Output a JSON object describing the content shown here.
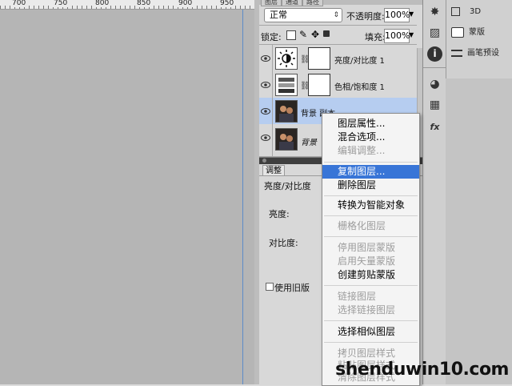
{
  "ruler": {
    "labels": [
      "700",
      "750",
      "800",
      "850",
      "900",
      "950"
    ]
  },
  "layers_panel": {
    "tab_layers": "图层",
    "tab_channels": "通道",
    "tab_paths": "路径",
    "blend_mode": "正常",
    "opacity_label": "不透明度:",
    "opacity_value": "100%",
    "lock_label": "锁定:",
    "fill_label": "填充:",
    "fill_value": "100%",
    "layers": [
      {
        "name": "亮度/对比度 1",
        "kind": "brightness-adjustment"
      },
      {
        "name": "色相/饱和度 1",
        "kind": "hue-saturation-adjustment"
      },
      {
        "name": "背景 副本",
        "kind": "photo",
        "selected": true
      },
      {
        "name": "背景",
        "kind": "photo"
      }
    ]
  },
  "adjustments": {
    "tab": "调整",
    "title": "亮度/对比度",
    "brightness_label": "亮度:",
    "contrast_label": "对比度:",
    "legacy_label": "使用旧版"
  },
  "right_panel": {
    "items": [
      "3D",
      "蒙版",
      "画笔预设"
    ]
  },
  "context_menu": {
    "items": [
      {
        "label": "图层属性...",
        "disabled": false
      },
      {
        "label": "混合选项...",
        "disabled": false
      },
      {
        "label": "编辑调整...",
        "disabled": true
      },
      {
        "label": "复制图层...",
        "disabled": false,
        "highlighted": true
      },
      {
        "label": "删除图层",
        "disabled": false
      },
      {
        "label": "转换为智能对象",
        "disabled": false
      },
      {
        "label": "栅格化图层",
        "disabled": true
      },
      {
        "label": "停用图层蒙版",
        "disabled": true
      },
      {
        "label": "启用矢量蒙版",
        "disabled": true
      },
      {
        "label": "创建剪贴蒙版",
        "disabled": false
      },
      {
        "label": "链接图层",
        "disabled": true
      },
      {
        "label": "选择链接图层",
        "disabled": true
      },
      {
        "label": "选择相似图层",
        "disabled": false
      },
      {
        "label": "拷贝图层样式",
        "disabled": true
      },
      {
        "label": "粘贴图层样式",
        "disabled": true
      },
      {
        "label": "清除图层样式",
        "disabled": true
      }
    ]
  },
  "watermark": {
    "text": "shenduwin10.com"
  },
  "colors": {
    "highlight": "#3875d7",
    "selected_layer": "#b6cdf0"
  }
}
